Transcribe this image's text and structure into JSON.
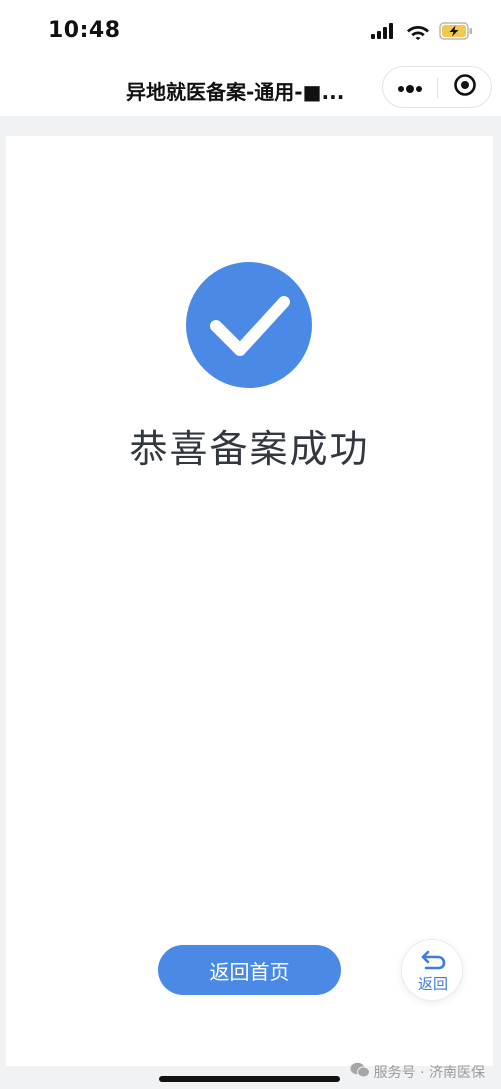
{
  "status_bar": {
    "time": "10:48"
  },
  "nav": {
    "title": "异地就医备案-通用-■...",
    "more_icon": "more-dots-icon",
    "close_icon": "target-close-icon"
  },
  "result": {
    "icon": "checkmark-icon",
    "title": "恭喜备案成功"
  },
  "actions": {
    "home_label": "返回首页",
    "back_label": "返回"
  },
  "watermark": {
    "text": "服务号 · 济南医保"
  },
  "colors": {
    "primary": "#4a8ae6",
    "title_text": "#333840",
    "background": "#f1f2f4"
  }
}
